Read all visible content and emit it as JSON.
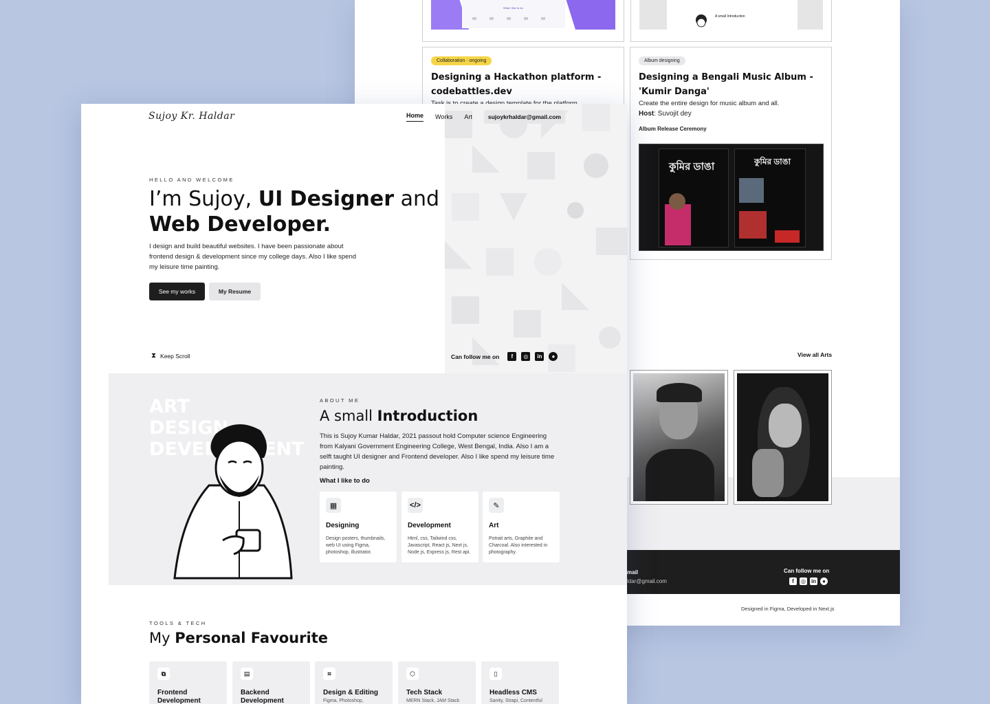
{
  "back": {
    "cards": [
      {
        "tag": "Collaboration · ongoing",
        "title": "Designing a Hackathon platform - codebattles.dev",
        "desc": "Task is to create a design template for the platform"
      },
      {
        "tag": "Album designing",
        "title": "Designing a Bengali Music Album - 'Kumir Danga'",
        "desc": "Create the entire design for music album and all.",
        "host_label": "Host",
        "host": ": Suvojit dey",
        "ceremony": "Album Release Ceremony"
      }
    ],
    "thumb_text": {
      "intro_small": "A small Introduction",
      "purple_heading": "What I like to do"
    },
    "poster_text": {
      "left_big": "কুমির ডাঙা",
      "right_big": "কুমির ডাঙা"
    },
    "view_all_arts": "View all Arts",
    "footer": {
      "email_label": "mail",
      "email": "ldar@gmail.com",
      "follow": "Can follow me on",
      "credit": "Designed in Figma, Developed in Next.js"
    }
  },
  "front": {
    "logo": "Sujoy Kr. Haldar",
    "nav": {
      "home": "Home",
      "works": "Works",
      "art": "Art",
      "email": "sujoykrhaldar@gmail.com"
    },
    "hero": {
      "eyebrow": "HELLO AND WELCOME",
      "title_pre": "I’m Sujoy, ",
      "title_bold1": "UI Designer",
      "title_mid": " and",
      "title_bold2": "Web Developer.",
      "paragraph": "I design and build beautiful websites. I have been passionate about frontend design & development since my college days. Also I like spend my leisure time painting.",
      "btn_works": "See my works",
      "btn_resume": "My Resume",
      "keep_scroll": "Keep Scroll",
      "follow": "Can follow me on"
    },
    "about": {
      "ghost": [
        "ART",
        "DESIGN",
        "DEVELOPMENT"
      ],
      "eyebrow": "ABOUT ME",
      "title_pre": "A small ",
      "title_bold": "Introduction",
      "paragraph": "This is Sujoy Kumar Haldar, 2021 passout hold Computer science Engineering from Kalyani Government Engineering College, West Bengal, India. Also I am a selft taught UI designer and Frontend developer. Also I like spend my leisure time painting.",
      "subheading": "What I like to do",
      "skills": [
        {
          "title": "Designing",
          "desc": "Design posters, thumbnails, web UI using Figma, photoshop, illustrator."
        },
        {
          "title": "Development",
          "desc": "Html, css, Tailwind css, Javascript, React js, Next js, Node js, Express js, Rest api."
        },
        {
          "title": "Art",
          "desc": "Potrait arts, Graphite and Charcoal. Also interested in photography."
        }
      ]
    },
    "tools": {
      "eyebrow": "TOOLS & TECH",
      "title_pre": "My ",
      "title_bold": "Personal Favourite",
      "items": [
        {
          "title": "Frontend Development",
          "desc": ""
        },
        {
          "title": "Backend Development",
          "desc": ""
        },
        {
          "title": "Design & Editing",
          "desc": "Figma, Photoshop,"
        },
        {
          "title": "Tech Stack",
          "desc": "MERN Stack, JAM Stack"
        },
        {
          "title": "Headless CMS",
          "desc": "Sanity, Strapi, Contentful"
        }
      ]
    }
  },
  "icons": [
    "facebook-icon",
    "instagram-icon",
    "linkedin-icon",
    "github-icon",
    "hourglass-icon"
  ],
  "colors": {
    "background": "#b8c6e2",
    "dark": "#1e1e1e",
    "panel": "#efeff1",
    "tag_yellow": "#f5d547",
    "purple": "#8b6cf0"
  }
}
